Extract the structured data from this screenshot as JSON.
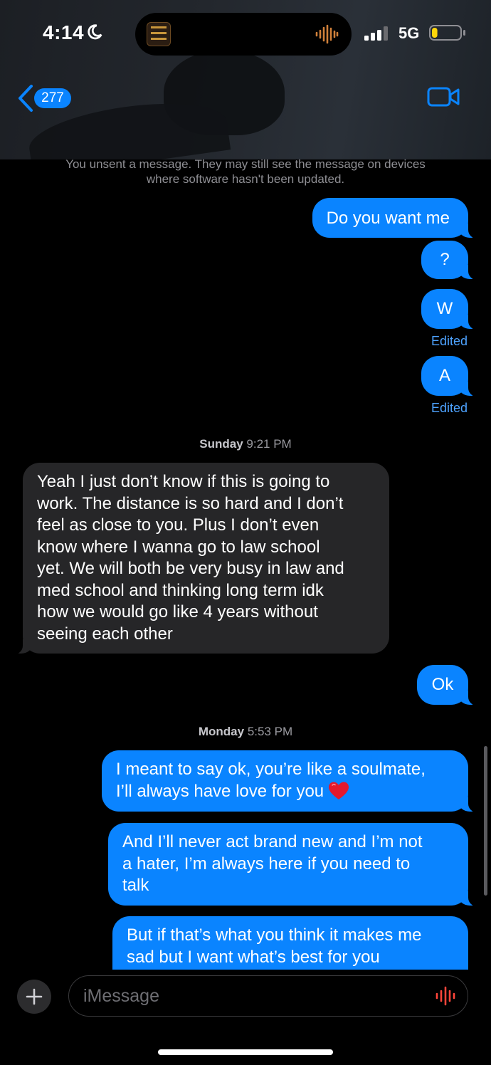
{
  "status_bar": {
    "time": "4:14",
    "network": "5G",
    "now_playing_art_icon": "album-art-icon",
    "battery_level": 0.2,
    "battery_color": "#ffd60a"
  },
  "nav": {
    "back_count": "277",
    "accent": "#0a84ff"
  },
  "thread": {
    "unsend_notice_line1": "You unsent a message. They may still see the message on devices",
    "unsend_notice_line2": "where software hasn't been updated.",
    "messages": [
      {
        "from": "me",
        "text": "Do you want me"
      },
      {
        "from": "me",
        "text": "?"
      },
      {
        "from": "me",
        "text": "W",
        "status": "Edited"
      },
      {
        "from": "me",
        "text": "A",
        "status": "Edited"
      }
    ],
    "timestamp_1": {
      "day": "Sunday",
      "time": "9:21 PM"
    },
    "incoming": {
      "from": "them",
      "lines": [
        "Yeah I just don’t know if this is going to",
        "work. The distance is so hard and I don’t",
        "feel as close to you. Plus I don’t even",
        "know where I wanna go to law school",
        "yet. We will both be very busy in law and",
        "med school and thinking long term idk",
        "how we would go like 4 years without",
        "seeing each other"
      ]
    },
    "reply_ok": "Ok",
    "timestamp_2": {
      "day": "Monday",
      "time": "5:53 PM"
    },
    "later_messages": [
      {
        "from": "me",
        "lines": [
          "I meant to say ok, you’re like a soulmate,",
          "I’ll always have love for you"
        ],
        "emoji": "heart-icon"
      },
      {
        "from": "me",
        "lines": [
          "And I’ll never act brand new and I’m not",
          "a hater, I’m always here if you need to",
          "talk"
        ]
      },
      {
        "from": "me",
        "lines": [
          "But if that’s what you think it makes me",
          "sad but I want what’s best for you"
        ]
      }
    ],
    "sent_color": "#0a84ff",
    "received_color": "#262628"
  },
  "composer": {
    "placeholder": "iMessage"
  }
}
